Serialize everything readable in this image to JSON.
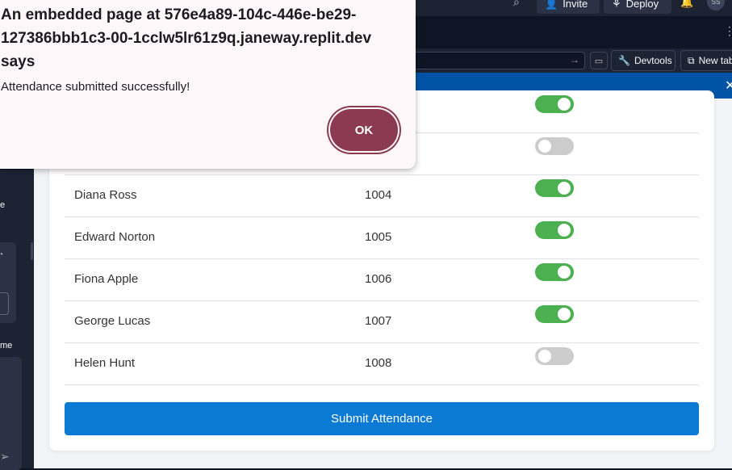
{
  "topbar": {
    "invite_label": "Invite",
    "deploy_label": "Deploy",
    "avatar_initials": "SS"
  },
  "toolbar": {
    "devtools_label": "Devtools",
    "new_tab_label": "New tab"
  },
  "sidebar": {
    "fragment_1": "e",
    "fragment_2": "me"
  },
  "dialog": {
    "title": "An embedded page at 576e4a89-104c-446e-be29-127386bbb1c3-00-1cclw5lr61z9q.janeway.replit.dev says",
    "message": "Attendance submitted successfully!",
    "ok_label": "OK"
  },
  "attendance": {
    "rows": [
      {
        "present": true
      },
      {
        "present": false
      },
      {
        "name": "Diana Ross",
        "id": "1004",
        "present": true
      },
      {
        "name": "Edward Norton",
        "id": "1005",
        "present": true
      },
      {
        "name": "Fiona Apple",
        "id": "1006",
        "present": true
      },
      {
        "name": "George Lucas",
        "id": "1007",
        "present": true
      },
      {
        "name": "Helen Hunt",
        "id": "1008",
        "present": false
      }
    ],
    "submit_label": "Submit Attendance"
  },
  "colors": {
    "toggle_on": "#4caf50",
    "toggle_off": "#cccccc",
    "submit_button": "#0b7ad4",
    "ok_button": "#8b3a52",
    "banner": "#0053a6"
  }
}
